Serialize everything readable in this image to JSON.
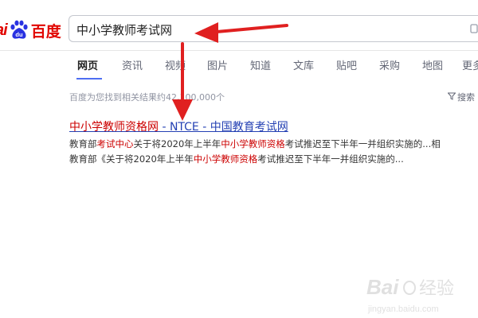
{
  "header": {
    "logo_latin": "ai",
    "logo_paw_text": "du",
    "logo_cn": "百度",
    "search_value": "中小学教师考试网"
  },
  "tabs": [
    {
      "label": "网页",
      "active": true
    },
    {
      "label": "资讯"
    },
    {
      "label": "视频"
    },
    {
      "label": "图片"
    },
    {
      "label": "知道"
    },
    {
      "label": "文库"
    },
    {
      "label": "贴吧"
    },
    {
      "label": "采购"
    },
    {
      "label": "地图"
    },
    {
      "label": "更多"
    }
  ],
  "results": {
    "count_text": "百度为您找到相关结果约42,100,000个",
    "tools_label": "搜索",
    "title_highlight": "中小学教师资格网",
    "title_rest": " - NTCE - 中国教育考试网",
    "snippet1": {
      "p1": "教育部",
      "h1": "考试中心",
      "p2": "关于将2020年上半年",
      "h2": "中小学教师资格",
      "p3": "考试推迟至下半年一并组织实施的...相"
    },
    "snippet2": {
      "p1": "教育部《关于将2020年上半年",
      "h1": "中小学教师资格",
      "p2": "考试推迟至下半年一并组织实施的..."
    }
  },
  "watermark": {
    "brand": "Bai",
    "brand_cn": "经验",
    "url": "jingyan.baidu.com"
  },
  "colors": {
    "brand_red": "#e10601",
    "link_blue": "#2440b3",
    "highlight_red": "#c00",
    "arrow_red": "#e02020",
    "tab_accent": "#4e6ef2"
  },
  "icons": [
    "baidu-paw-icon",
    "camera-icon",
    "funnel-icon",
    "annotation-arrow-icon"
  ]
}
